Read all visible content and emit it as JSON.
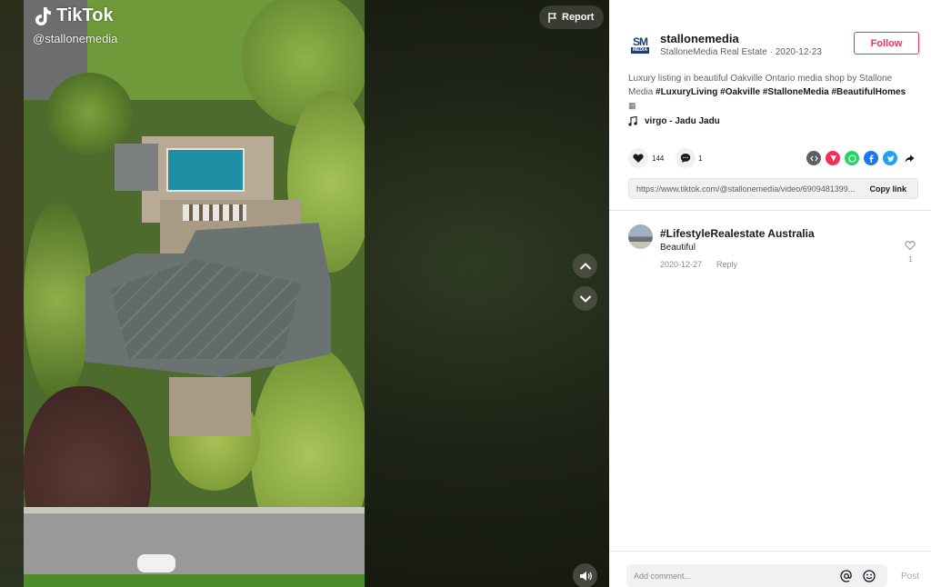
{
  "video": {
    "brand": "TikTok",
    "handle": "@stallonemedia",
    "report_label": "Report",
    "icons": [
      "tiktok-logo-icon",
      "flag-icon",
      "chevron-up-icon",
      "chevron-down-icon",
      "volume-icon"
    ]
  },
  "author": {
    "avatar_text_top": "SM",
    "avatar_text_bottom": "MEDIA",
    "username": "stallonemedia",
    "subline": "StalloneMedia Real Estate · 2020-12-23",
    "follow_label": "Follow"
  },
  "post": {
    "description_prefix": "Luxury listing in beautiful Oakville Ontario media shop by Stallone Media ",
    "hashtags": [
      "#LuxuryLiving",
      "#Oakville",
      "#StalloneMedia",
      "#BeautifulHomes"
    ],
    "description_suffix": "",
    "music": "virgo - Jadu Jadu",
    "likes": "144",
    "comments": "1",
    "share_icons": [
      "embed-icon",
      "send-icon",
      "whatsapp-icon",
      "facebook-icon",
      "twitter-icon",
      "share-arrow-icon"
    ],
    "link": "https://www.tiktok.com/@stallonemedia/video/6909481399...",
    "copy_link_label": "Copy link"
  },
  "comments_list": [
    {
      "user": "#LifestyleRealestate Australia",
      "text": "Beautiful",
      "date": "2020-12-27",
      "reply_label": "Reply",
      "likes": "1"
    }
  ],
  "composer": {
    "placeholder": "Add comment...",
    "post_label": "Post"
  },
  "colors": {
    "accent": "#fe2c55",
    "text": "#161823",
    "muted": "#5e5f66",
    "whatsapp": "#25d366",
    "facebook": "#1877f2",
    "twitter": "#1da1f2",
    "send": "#fe2c55",
    "embed": "#5e5f66"
  }
}
